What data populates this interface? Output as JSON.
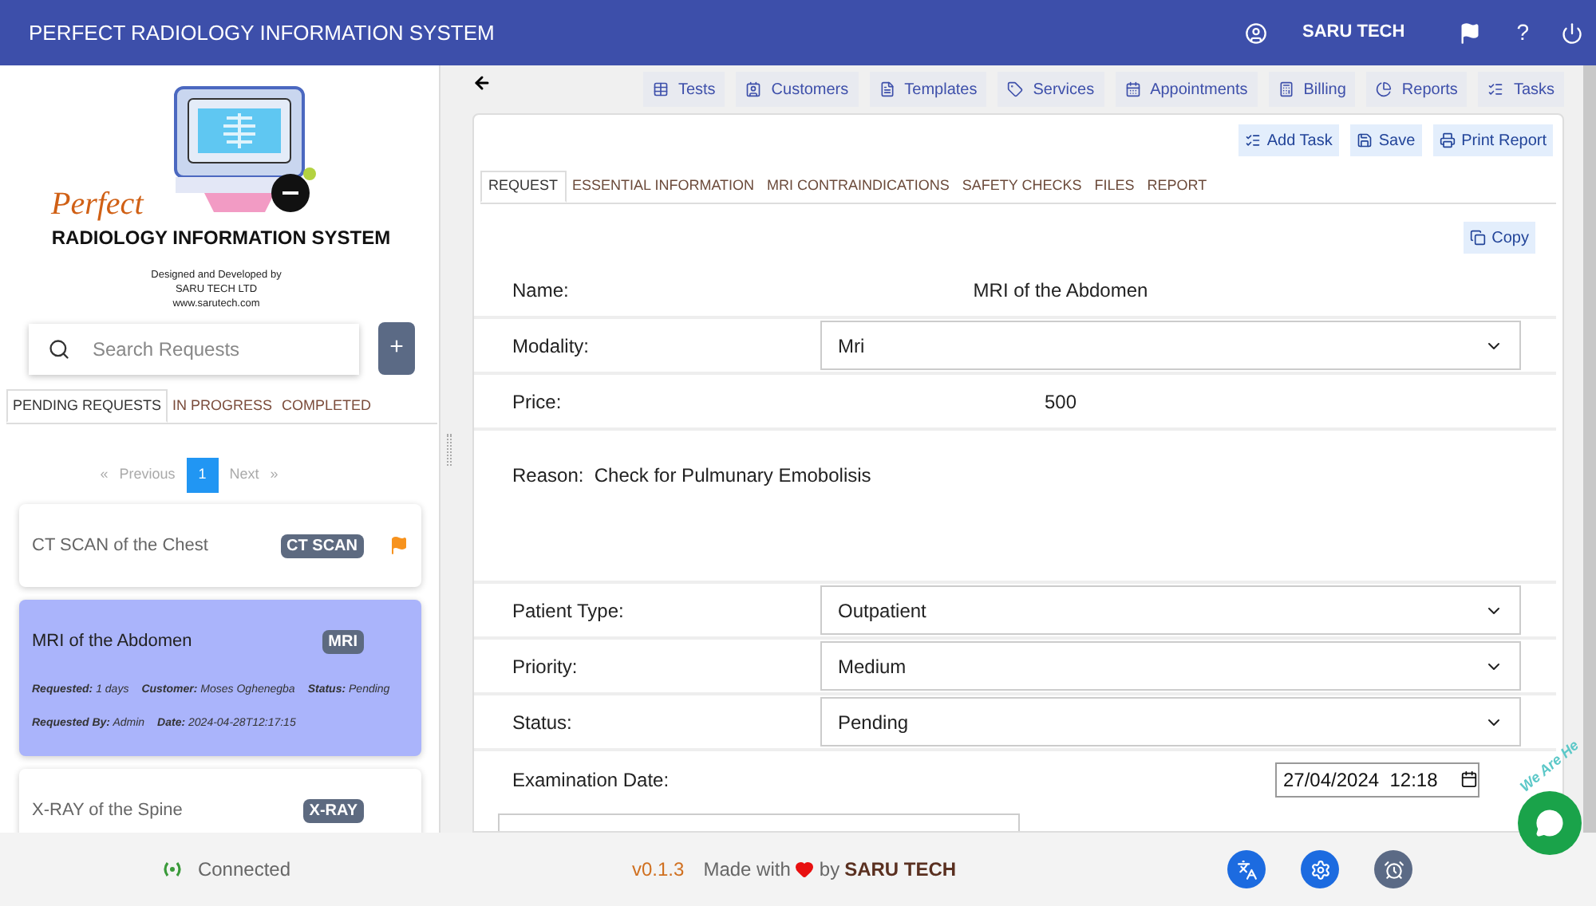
{
  "header": {
    "title": "PERFECT RADIOLOGY INFORMATION SYSTEM",
    "user": "SARU TECH",
    "help": "?"
  },
  "logo": {
    "word": "Perfect",
    "title": "RADIOLOGY INFORMATION SYSTEM",
    "credits": [
      "Designed and Developed by",
      "SARU TECH LTD",
      "www.sarutech.com"
    ]
  },
  "search": {
    "placeholder": "Search Requests",
    "add": "+"
  },
  "request_tabs": [
    {
      "label": "PENDING REQUESTS",
      "selected": true
    },
    {
      "label": "IN PROGRESS",
      "selected": false
    },
    {
      "label": "COMPLETED",
      "selected": false
    }
  ],
  "pagination": {
    "prev_glyph": "«",
    "previous": "Previous",
    "page": "1",
    "next": "Next",
    "next_glyph": "»"
  },
  "requests": [
    {
      "title": "CT SCAN of the Chest",
      "badge": "CT SCAN",
      "flagged": true,
      "selected": false
    },
    {
      "title": "MRI of the Abdomen",
      "badge": "MRI",
      "flagged": false,
      "selected": true,
      "details": [
        {
          "label": "Requested:",
          "value": "1 days"
        },
        {
          "label": "Customer:",
          "value": "Moses Oghenegba"
        },
        {
          "label": "Status:",
          "value": "Pending"
        },
        {
          "label": "Requested By:",
          "value": "Admin"
        },
        {
          "label": "Date:",
          "value": "2024-04-28T12:17:15"
        }
      ]
    },
    {
      "title": "X-RAY of the Spine",
      "badge": "X-RAY",
      "flagged": false,
      "selected": false
    }
  ],
  "nav_buttons": [
    "Tests",
    "Customers",
    "Templates",
    "Services",
    "Appointments",
    "Billing",
    "Reports",
    "Tasks"
  ],
  "actions": [
    "Add Task",
    "Save",
    "Print Report"
  ],
  "form_tabs": [
    {
      "label": "REQUEST",
      "selected": true
    },
    {
      "label": "ESSENTIAL INFORMATION",
      "selected": false
    },
    {
      "label": "MRI CONTRAINDICATIONS",
      "selected": false
    },
    {
      "label": "SAFETY CHECKS",
      "selected": false
    },
    {
      "label": "FILES",
      "selected": false
    },
    {
      "label": "REPORT",
      "selected": false
    }
  ],
  "copy": "Copy",
  "fields": [
    {
      "kind": "text",
      "label": "Name:",
      "value": "MRI of the Abdomen"
    },
    {
      "kind": "select",
      "label": "Modality:",
      "value": "Mri"
    },
    {
      "kind": "text",
      "label": "Price:",
      "value": "500"
    },
    {
      "kind": "reason",
      "label": "Reason:",
      "value": "Check for Pulmunary Emobolisis"
    },
    {
      "kind": "select",
      "label": "Patient Type:",
      "value": "Outpatient"
    },
    {
      "kind": "select",
      "label": "Priority:",
      "value": "Medium"
    },
    {
      "kind": "select",
      "label": "Status:",
      "value": "Pending"
    },
    {
      "kind": "date",
      "label": "Examination Date:",
      "value": "27/04/2024  12:18"
    }
  ],
  "footer": {
    "status": "Connected",
    "version": "v0.1.3",
    "made_with": "Made with",
    "by": "by",
    "brand": "SARU TECH"
  },
  "chat_widget": {
    "text": "We Are He"
  }
}
